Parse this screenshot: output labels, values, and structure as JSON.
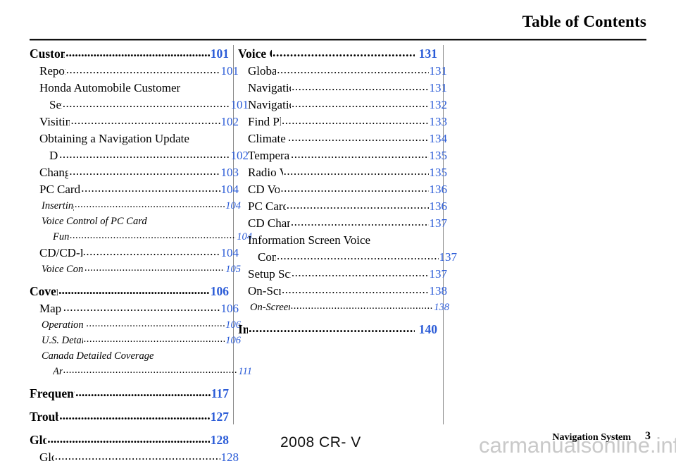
{
  "header": {
    "title": "Table of Contents"
  },
  "colors": {
    "page_number_blue": "#2a5bd7",
    "text_black": "#000000",
    "rule_black": "#111111",
    "divider_gray": "#8a8a8a",
    "watermark_gray": "#c9c9c9"
  },
  "columns": {
    "left": [
      {
        "level": 1,
        "label": "Customer Assistance",
        "page": "101"
      },
      {
        "level": 2,
        "label": "Reporting Errors",
        "page": "101"
      },
      {
        "level": 2,
        "label": "Honda Automobile Customer",
        "page": "",
        "wrap": true
      },
      {
        "level": 2,
        "label": "Service",
        "page": "101",
        "continuation": true
      },
      {
        "level": 2,
        "label": "Visiting Your Dealer",
        "page": "102"
      },
      {
        "level": 2,
        "label": "Obtaining a Navigation Update",
        "page": "",
        "wrap": true
      },
      {
        "level": 2,
        "label": "DVD",
        "page": "102",
        "continuation": true
      },
      {
        "level": 2,
        "label": "Changing the DVD",
        "page": "103"
      },
      {
        "level": 2,
        "label": "PC Card Operation with Navi",
        "page": "104"
      },
      {
        "level": 3,
        "label": "Inserting the PC Card",
        "page": "104"
      },
      {
        "level": 3,
        "label": "Voice Control of PC Card",
        "page": "",
        "wrap": true
      },
      {
        "level": 3,
        "label": "Functions",
        "page": "104",
        "continuation": true
      },
      {
        "level": 2,
        "label": "CD/CD-R Operation with Navi",
        "page": "104"
      },
      {
        "level": 3,
        "label": "Voice Control of CD Functions",
        "page": "105"
      },
      {
        "level": 1,
        "label": "Coverage Areas",
        "page": "106"
      },
      {
        "level": 2,
        "label": "Map Coverage",
        "page": "106"
      },
      {
        "level": 3,
        "label": "Operation in Hawaii and Alaska",
        "page": "106"
      },
      {
        "level": 3,
        "label": "U.S. Detailed Coverage Areas",
        "page": "106"
      },
      {
        "level": 3,
        "label": "Canada Detailed Coverage",
        "page": "",
        "wrap": true
      },
      {
        "level": 3,
        "label": "Areas",
        "page": "111",
        "continuation": true
      },
      {
        "level": 1,
        "label": "Frequently Asked Questions",
        "page": "117"
      },
      {
        "level": 1,
        "label": "Troubleshooting",
        "page": "127"
      },
      {
        "level": 1,
        "label": "Glossary",
        "page": "128"
      },
      {
        "level": 2,
        "label": "Glossary",
        "page": "128"
      }
    ],
    "right": [
      {
        "level": 1,
        "label": "Voice Command Index",
        "page": "131"
      },
      {
        "level": 2,
        "label": "Global Commands",
        "page": "131"
      },
      {
        "level": 2,
        "label": "Navigation General Commands",
        "page": "131"
      },
      {
        "level": 2,
        "label": "Navigation Display Commands",
        "page": "132"
      },
      {
        "level": 2,
        "label": "Find Place Commands",
        "page": "133"
      },
      {
        "level": 2,
        "label": "Climate Control Commands",
        "page": "134"
      },
      {
        "level": 2,
        "label": "Temperature Voice Commands",
        "page": "135"
      },
      {
        "level": 2,
        "label": "Radio Voice Commands",
        "page": "135"
      },
      {
        "level": 2,
        "label": "CD Voice Commands",
        "page": "136"
      },
      {
        "level": 2,
        "label": "PC Card Voice Commands",
        "page": "136"
      },
      {
        "level": 2,
        "label": "CD Changer Voice Commands",
        "page": "137"
      },
      {
        "level": 2,
        "label": "Information Screen Voice",
        "page": "",
        "wrap": true
      },
      {
        "level": 2,
        "label": "Commands",
        "page": "137",
        "continuation": true
      },
      {
        "level": 2,
        "label": "Setup Screen (first) Commands",
        "page": "137"
      },
      {
        "level": 2,
        "label": "On-Screen Commands",
        "page": "138"
      },
      {
        "level": 3,
        "label": "On-Screen Commands Assist",
        "page": "138"
      },
      {
        "level": 1,
        "label": "Index",
        "page": "140"
      }
    ]
  },
  "footer": {
    "model_year": "2008  CR- V",
    "section": "Navigation System",
    "page": "3",
    "watermark": "carmanualsonline.info"
  }
}
